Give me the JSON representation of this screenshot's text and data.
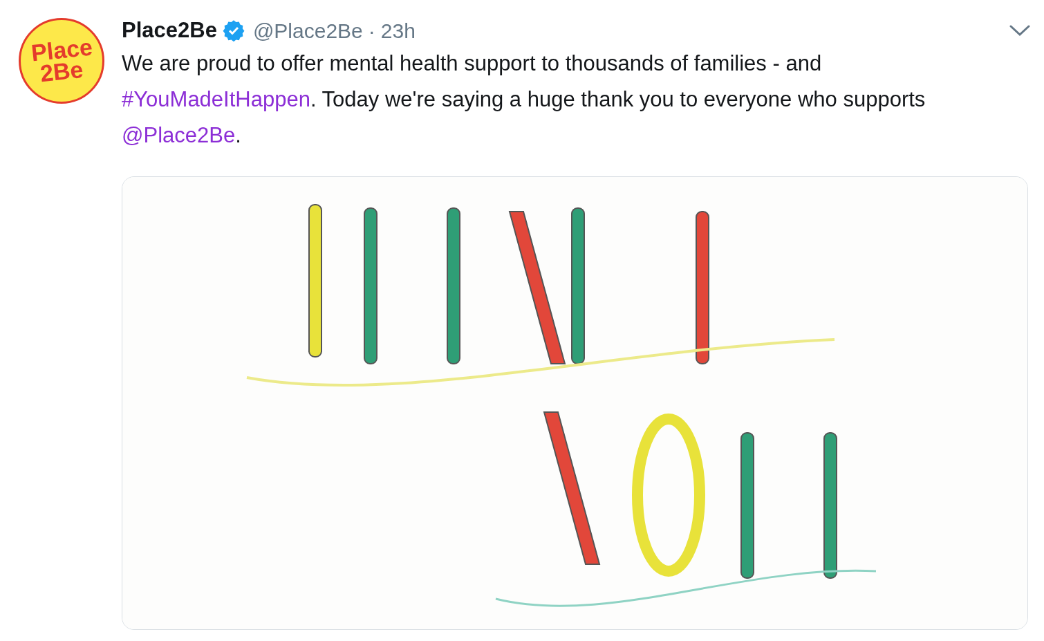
{
  "tweet": {
    "avatar": {
      "lines": [
        "Place",
        "2Be"
      ]
    },
    "name": "Place2Be",
    "verified": true,
    "handle": "@Place2Be",
    "separator": "·",
    "time": "23h",
    "text": [
      {
        "kind": "text",
        "value": "We are proud to offer mental health support to thousands of families - and "
      },
      {
        "kind": "hashtag",
        "value": "#YouMadeItHappen"
      },
      {
        "kind": "text",
        "value": ". Today we're saying a huge thank you to everyone who supports "
      },
      {
        "kind": "mention",
        "value": "@Place2Be"
      },
      {
        "kind": "text",
        "value": "."
      }
    ]
  }
}
